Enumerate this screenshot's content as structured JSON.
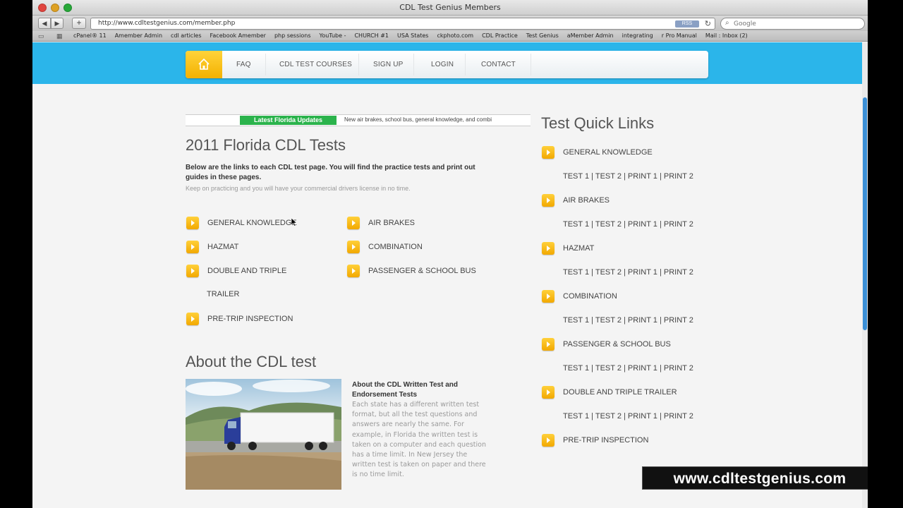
{
  "browser": {
    "window_title": "CDL Test Genius Members",
    "url": "http://www.cdltestgenius.com/member.php",
    "rss_label": "RSS",
    "search_placeholder": "Google",
    "nav_back": "◀",
    "nav_forward": "▶",
    "nav_add": "+",
    "bookmarks": [
      "cPanel® 11",
      "Amember Admin",
      "cdl articles",
      "Facebook Amember",
      "php sessions",
      "YouTube -",
      "CHURCH #1",
      "USA States",
      "ckphoto.com",
      "CDL Practice",
      "Test Genius",
      "aMember Admin",
      "integrating",
      "r Pro Manual",
      "Mail : Inbox (2)"
    ]
  },
  "nav": {
    "items": [
      "FAQ",
      "CDL TEST COURSES",
      "SIGN UP",
      "LOGIN",
      "CONTACT"
    ]
  },
  "ticker": {
    "label": "Latest Florida Updates",
    "text": "New air brakes, school bus, general knowledge, and combi"
  },
  "main": {
    "title": "2011 Florida CDL Tests",
    "intro_bold": "Below are the links to each CDL test page. You will find the practice tests and print out guides in these pages.",
    "intro_sub": "Keep on practicing and you will have your commercial drivers license in no time.",
    "tests": [
      "GENERAL KNOWLEDGE",
      "AIR BRAKES",
      "HAZMAT",
      "COMBINATION",
      "DOUBLE AND TRIPLE",
      "PASSENGER & SCHOOL BUS",
      "PRE-TRIP INSPECTION"
    ],
    "trailer_line": "TRAILER"
  },
  "about": {
    "title": "About the CDL test",
    "subtitle": "About the CDL Written Test and Endorsement Tests",
    "body": "Each state has a different written test format, but all the test questions and answers are nearly the same. For example, in Florida the written test is taken on a computer and each question has a time limit. In New Jersey the written test is taken on paper and there is no time limit."
  },
  "sidebar": {
    "title": "Test Quick Links",
    "items": [
      {
        "label": "GENERAL KNOWLEDGE",
        "links": "TEST 1 | TEST 2 | PRINT 1 | PRINT 2"
      },
      {
        "label": "AIR BRAKES",
        "links": "TEST 1 | TEST 2 | PRINT 1 | PRINT 2"
      },
      {
        "label": "HAZMAT",
        "links": "TEST 1 | TEST 2 | PRINT 1 | PRINT 2"
      },
      {
        "label": "COMBINATION",
        "links": "TEST 1 | TEST 2 | PRINT 1 | PRINT 2"
      },
      {
        "label": "PASSENGER & SCHOOL BUS",
        "links": "TEST 1 | TEST 2 | PRINT 1 | PRINT 2"
      },
      {
        "label": "DOUBLE AND TRIPLE TRAILER",
        "links": "TEST 1 | TEST 2 | PRINT 1 | PRINT 2"
      },
      {
        "label": "PRE-TRIP INSPECTION",
        "links": ""
      }
    ]
  },
  "watermark": "www.cdltestgenius.com",
  "colors": {
    "header_blue": "#2bb5ea",
    "accent_yellow": "#f7b900",
    "ticker_green": "#2bb34c"
  }
}
